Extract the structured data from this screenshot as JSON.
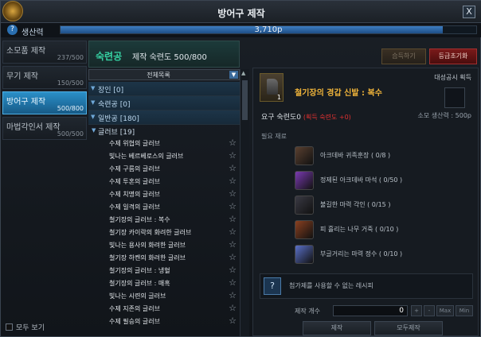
{
  "window": {
    "title": "방어구 제작",
    "close_label": "X"
  },
  "production": {
    "label": "생산력",
    "value_text": "3,710p",
    "progress": 0.92,
    "icon_glyph": "?"
  },
  "categories": [
    {
      "name": "소모품 제작",
      "progress": "237/500",
      "active": false
    },
    {
      "name": "무기 제작",
      "progress": "150/500",
      "active": false
    },
    {
      "name": "방어구 제작",
      "progress": "500/800",
      "active": true
    },
    {
      "name": "마법각인서 제작",
      "progress": "500/500",
      "active": false
    }
  ],
  "show_all_label": "모두 보기",
  "skill": {
    "grade": "숙련공",
    "proficiency": "제작 숙련도 500/800"
  },
  "list_dropdown": {
    "selected": "전체목록"
  },
  "groups": [
    {
      "label": "장인 [0]"
    },
    {
      "label": "숙련공 [0]"
    },
    {
      "label": "일반공 [180]"
    }
  ],
  "subgroup": {
    "label": "글러브 [19]"
  },
  "items": [
    "수제 위협의 글러브",
    "빛나는 베르베로스의 글러브",
    "수제 구름의 글러브",
    "수제 투혼의 글러브",
    "수제 치명의 글러브",
    "수제 일격의 글러브",
    "철기장의 글러브 : 복수",
    "철기장 카이락의 화려한 글러브",
    "빛나는 용사의 화려한 글러브",
    "철기장 하켄의 화려한 글러브",
    "철기장의 글러브 : 냉혈",
    "철기장의 글러브 : 매혹",
    "빛나는 시련의 글러브",
    "수제 지존의 글러브",
    "수제 필승의 글러브"
  ],
  "buttons": {
    "learn": "습득하기",
    "upgrade": "등급초기화"
  },
  "recipe": {
    "name": "철기장의 경갑 신발 : 복수",
    "count": "1",
    "reward_label": "대성공시 획득",
    "requirement": "요구 숙련도0",
    "requirement_warn": "(획득 숙련도 +0)",
    "cost": "소모 생산력 : 500p",
    "materials_header": "필요 재료"
  },
  "materials": [
    {
      "name": "아크데바 귀족훈장 ( 0/8 )",
      "color": "#5a4030"
    },
    {
      "name": "정제된 아크데바 마석 ( 0/50 )",
      "color": "#7a3ab0"
    },
    {
      "name": "불길한 마력 각인 ( 0/15 )",
      "color": "#3a3a44"
    },
    {
      "name": "피 흘리는 나무 거죽 ( 0/10 )",
      "color": "#8a4020"
    },
    {
      "name": "부글거리는 마력 정수 ( 0/10 )",
      "color": "#5a70c8"
    }
  ],
  "note": {
    "icon": "?",
    "text": "첨가제를 사용할 수 없는 레시피"
  },
  "quantity": {
    "label": "제작 개수",
    "value": "0",
    "max": "Max",
    "min": "Min",
    "plus": "+",
    "minus": "-"
  },
  "actions": {
    "craft": "제작",
    "craft_all": "모두제작"
  }
}
